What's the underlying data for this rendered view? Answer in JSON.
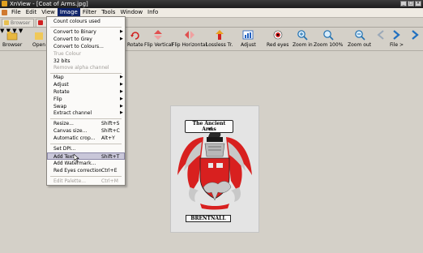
{
  "window": {
    "title": "XnView - [Coat of Arms.jpg]",
    "buttons": [
      "_",
      "□",
      "×"
    ]
  },
  "menubar": {
    "items": [
      {
        "label": "File"
      },
      {
        "label": "Edit"
      },
      {
        "label": "View"
      },
      {
        "label": "Image",
        "active": true
      },
      {
        "label": "Filter"
      },
      {
        "label": "Tools"
      },
      {
        "label": "Window"
      },
      {
        "label": "Info"
      }
    ]
  },
  "tabs": [
    {
      "label": "Browser"
    }
  ],
  "toolbar": {
    "buttons": {
      "browser": "Browser",
      "open": "Open",
      "rotate": "Rotate",
      "flip_vertical": "Flip Vertical",
      "flip_horizontal": "Flip Horizontal",
      "lossless": "Lossless Tr.",
      "adjust": "Adjust",
      "red_eyes": "Red eyes",
      "zoom_in": "Zoom in",
      "zoom_100": "Zoom 100%",
      "zoom_out": "Zoom out",
      "file_next": "File >"
    }
  },
  "image_menu": {
    "items": [
      {
        "label": "Count colours used",
        "disabled": false
      },
      {
        "label": "Convert to Binary",
        "submenu": true
      },
      {
        "label": "Convert to Grey",
        "submenu": true
      },
      {
        "label": "Convert to Colours..."
      },
      {
        "label": "True Colour",
        "disabled": true
      },
      {
        "label": "32 bits"
      },
      {
        "label": "Remove alpha channel",
        "disabled": true
      },
      {
        "label": "Map",
        "submenu": true
      },
      {
        "label": "Adjust",
        "submenu": true
      },
      {
        "label": "Rotate",
        "submenu": true
      },
      {
        "label": "Flip",
        "submenu": true
      },
      {
        "label": "Swap",
        "submenu": true
      },
      {
        "label": "Extract channel",
        "submenu": true
      },
      {
        "label": "Resize...",
        "shortcut": "Shift+S"
      },
      {
        "label": "Canvas size...",
        "shortcut": "Shift+C"
      },
      {
        "label": "Automatic crop...",
        "shortcut": "Alt+Y"
      },
      {
        "label": "Set DPI..."
      },
      {
        "label": "Add Text...",
        "shortcut": "Shift+T",
        "hover": true
      },
      {
        "label": "Add Watermark..."
      },
      {
        "label": "Red Eyes correction",
        "shortcut": "Ctrl+E"
      },
      {
        "label": "Edit Palette...",
        "shortcut": "Ctrl+M",
        "disabled": true
      }
    ]
  },
  "image": {
    "plaque_top_line1": "The Ancient Arms",
    "plaque_top_line2": "of",
    "plaque_bottom": "BRENTNALL"
  },
  "colors": {
    "accent_menu": "#10246a",
    "heraldic_red": "#d8201f",
    "silver": "#c8c8c8",
    "black": "#1a1a1a"
  }
}
